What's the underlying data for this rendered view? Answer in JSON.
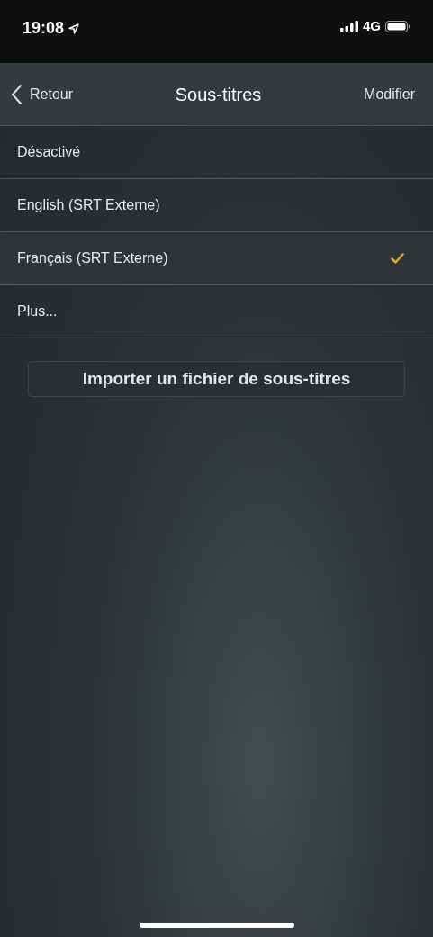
{
  "status_bar": {
    "time": "19:08",
    "network": "4G"
  },
  "nav": {
    "back": "Retour",
    "title": "Sous-titres",
    "action": "Modifier"
  },
  "options": [
    {
      "label": "Désactivé",
      "selected": false
    },
    {
      "label": "English (SRT Externe)",
      "selected": false
    },
    {
      "label": "Français (SRT Externe)",
      "selected": true
    },
    {
      "label": "Plus...",
      "selected": false
    }
  ],
  "import_button": "Importer un fichier de sous-titres"
}
